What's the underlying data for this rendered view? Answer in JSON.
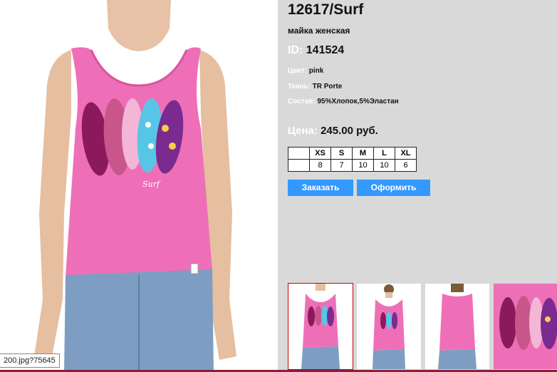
{
  "product": {
    "title": "12617/Surf",
    "subtitle": "майка женская",
    "id_label": "ID:",
    "id_value": "141524",
    "color_label": "Цвет:",
    "color_value": "pink",
    "fabric_label": "Ткань:",
    "fabric_value": "TR Porte",
    "composition_label": "Состав:",
    "composition_value": "95%Хлопок,5%Эластан",
    "price_label": "Цена:",
    "price_value": "245.00 руб."
  },
  "sizes": {
    "headers": [
      "XS",
      "S",
      "M",
      "L",
      "XL"
    ],
    "quantities": [
      "8",
      "7",
      "10",
      "10",
      "6"
    ]
  },
  "buttons": {
    "order": "Заказать",
    "checkout": "Оформить"
  },
  "status_url": "200.jpg?75645",
  "colors": {
    "accent": "#3399ff",
    "panel_bg": "#d9d9d9",
    "shirt": "#ee6fb8",
    "jeans": "#7d9ec2"
  }
}
